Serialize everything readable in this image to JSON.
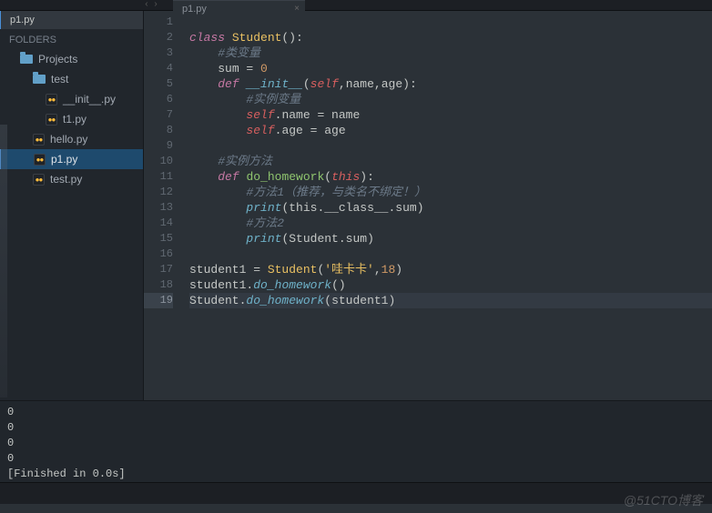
{
  "sidebar": {
    "tab": "p1.py",
    "header": "FOLDERS",
    "items": [
      {
        "label": "Projects",
        "type": "folder",
        "depth": 1
      },
      {
        "label": "test",
        "type": "folder",
        "depth": 2
      },
      {
        "label": "__init__.py",
        "type": "py",
        "depth": 3
      },
      {
        "label": "t1.py",
        "type": "py",
        "depth": 3
      },
      {
        "label": "hello.py",
        "type": "py",
        "depth": 2
      },
      {
        "label": "p1.py",
        "type": "py",
        "depth": 2,
        "selected": true
      },
      {
        "label": "test.py",
        "type": "py",
        "depth": 2
      }
    ]
  },
  "tab": {
    "title": "p1.py",
    "close": "×"
  },
  "code": {
    "lines": [
      [
        {
          "t": ""
        }
      ],
      [
        {
          "t": "class ",
          "c": "kw"
        },
        {
          "t": "Student",
          "c": "cls"
        },
        {
          "t": "():",
          "c": "punct"
        }
      ],
      [
        {
          "t": "    "
        },
        {
          "t": "#类变量",
          "c": "cmt"
        }
      ],
      [
        {
          "t": "    "
        },
        {
          "t": "sum",
          "c": "ident"
        },
        {
          "t": " = ",
          "c": "punct"
        },
        {
          "t": "0",
          "c": "num"
        }
      ],
      [
        {
          "t": "    "
        },
        {
          "t": "def ",
          "c": "kw"
        },
        {
          "t": "__init__",
          "c": "def"
        },
        {
          "t": "(",
          "c": "punct"
        },
        {
          "t": "self",
          "c": "self"
        },
        {
          "t": ",",
          "c": "punct"
        },
        {
          "t": "name",
          "c": "ident"
        },
        {
          "t": ",",
          "c": "punct"
        },
        {
          "t": "age",
          "c": "ident"
        },
        {
          "t": "):",
          "c": "punct"
        }
      ],
      [
        {
          "t": "        "
        },
        {
          "t": "#实例变量",
          "c": "cmt"
        }
      ],
      [
        {
          "t": "        "
        },
        {
          "t": "self",
          "c": "self"
        },
        {
          "t": ".name = name",
          "c": "ident"
        }
      ],
      [
        {
          "t": "        "
        },
        {
          "t": "self",
          "c": "self"
        },
        {
          "t": ".age = age",
          "c": "ident"
        }
      ],
      [
        {
          "t": ""
        }
      ],
      [
        {
          "t": "    "
        },
        {
          "t": "#实例方法",
          "c": "cmt"
        }
      ],
      [
        {
          "t": "    "
        },
        {
          "t": "def ",
          "c": "kw"
        },
        {
          "t": "do_homework",
          "c": "fn"
        },
        {
          "t": "(",
          "c": "punct"
        },
        {
          "t": "this",
          "c": "self"
        },
        {
          "t": "):",
          "c": "punct"
        }
      ],
      [
        {
          "t": "        "
        },
        {
          "t": "#方法1（推荐，与类名不绑定！）",
          "c": "cmt"
        }
      ],
      [
        {
          "t": "        "
        },
        {
          "t": "print",
          "c": "def"
        },
        {
          "t": "(",
          "c": "punct"
        },
        {
          "t": "this",
          "c": "ident"
        },
        {
          "t": ".__class__.sum",
          "c": "ident"
        },
        {
          "t": ")",
          "c": "punct"
        }
      ],
      [
        {
          "t": "        "
        },
        {
          "t": "#方法2",
          "c": "cmt"
        }
      ],
      [
        {
          "t": "        "
        },
        {
          "t": "print",
          "c": "def"
        },
        {
          "t": "(",
          "c": "punct"
        },
        {
          "t": "Student",
          "c": "ident"
        },
        {
          "t": ".sum",
          "c": "ident"
        },
        {
          "t": ")",
          "c": "punct"
        }
      ],
      [
        {
          "t": ""
        }
      ],
      [
        {
          "t": "student1",
          "c": "ident"
        },
        {
          "t": " = ",
          "c": "punct"
        },
        {
          "t": "Student",
          "c": "cls"
        },
        {
          "t": "(",
          "c": "punct"
        },
        {
          "t": "'哇卡卡'",
          "c": "str"
        },
        {
          "t": ",",
          "c": "punct"
        },
        {
          "t": "18",
          "c": "num"
        },
        {
          "t": ")",
          "c": "punct"
        }
      ],
      [
        {
          "t": "student1",
          "c": "ident"
        },
        {
          "t": ".",
          "c": "punct"
        },
        {
          "t": "do_homework",
          "c": "def"
        },
        {
          "t": "()",
          "c": "punct"
        }
      ],
      [
        {
          "t": "Student",
          "c": "ident"
        },
        {
          "t": ".",
          "c": "punct"
        },
        {
          "t": "do_homework",
          "c": "def"
        },
        {
          "t": "(",
          "c": "punct"
        },
        {
          "t": "student1",
          "c": "ident"
        },
        {
          "t": ")",
          "c": "punct"
        }
      ]
    ],
    "current": 19
  },
  "console": {
    "lines": [
      "0",
      "0",
      "0",
      "0",
      "[Finished in 0.0s]"
    ]
  },
  "watermark": "@51CTO博客"
}
